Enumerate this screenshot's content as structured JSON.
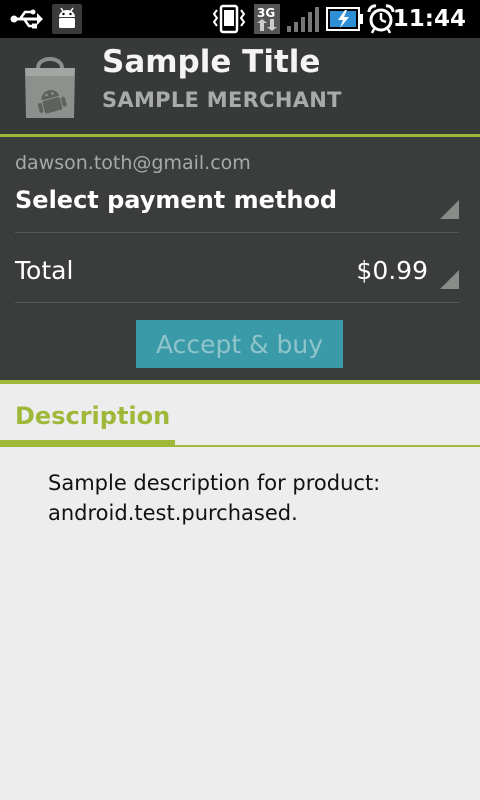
{
  "status_bar": {
    "icons": [
      "usb-icon",
      "android-debug-icon",
      "vibrate-icon",
      "3g-data-icon",
      "signal-icon",
      "battery-charging-icon",
      "alarm-icon"
    ],
    "time": "11:44"
  },
  "product": {
    "title": "Sample Title",
    "merchant": "SAMPLE MERCHANT",
    "icon": "shopping-bag-android-icon"
  },
  "account": {
    "email": "dawson.toth@gmail.com"
  },
  "payment": {
    "label": "Select payment method"
  },
  "total": {
    "label": "Total",
    "value": "$0.99"
  },
  "actions": {
    "accept_label": "Accept & buy"
  },
  "description": {
    "heading": "Description",
    "text": "Sample description for product: android.test.purchased."
  },
  "colors": {
    "accent_green": "#9fb83a",
    "button_teal": "#3a9aa8",
    "header_dark": "#3a3d3b"
  }
}
